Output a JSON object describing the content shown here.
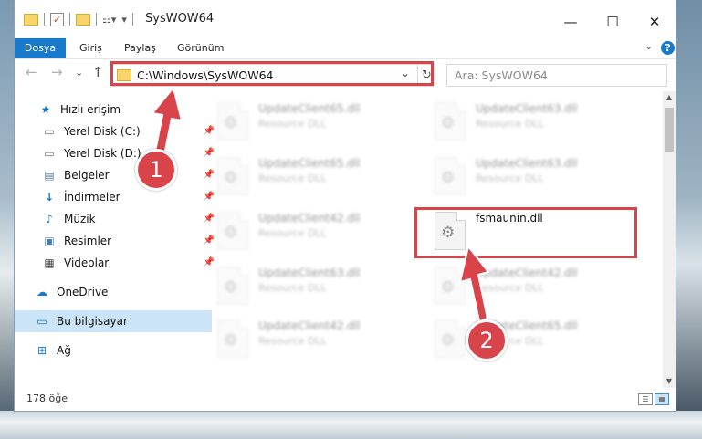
{
  "window": {
    "title": "SysWOW64"
  },
  "window_controls": {
    "minimize": "—",
    "maximize": "☐",
    "close": "✕"
  },
  "menu": {
    "items": [
      "Dosya",
      "Giriş",
      "Paylaş",
      "Görünüm"
    ]
  },
  "navigation": {
    "back": "←",
    "forward": "→",
    "recent": "⌄",
    "up": "↑"
  },
  "address": {
    "path": "C:\\Windows\\SysWOW64",
    "dropdown": "⌄",
    "refresh": "↻"
  },
  "search": {
    "placeholder": "Ara: SysWOW64"
  },
  "sidebar": {
    "items": [
      {
        "label": "Hızlı erişim",
        "icon": "star-icon"
      },
      {
        "label": "Yerel Disk (C:)",
        "icon": "drive-icon"
      },
      {
        "label": "Yerel Disk (D:)",
        "icon": "drive-icon"
      },
      {
        "label": "Belgeler",
        "icon": "documents-icon"
      },
      {
        "label": "İndirmeler",
        "icon": "download-icon"
      },
      {
        "label": "Müzik",
        "icon": "music-icon"
      },
      {
        "label": "Resimler",
        "icon": "pictures-icon"
      },
      {
        "label": "Videolar",
        "icon": "video-icon"
      },
      {
        "label": "OneDrive",
        "icon": "cloud-icon"
      },
      {
        "label": "Bu bilgisayar",
        "icon": "computer-icon"
      },
      {
        "label": "Ağ",
        "icon": "network-icon"
      }
    ]
  },
  "files": [
    {
      "name": "UpdateClient65.dll",
      "desc": "Resource DLL"
    },
    {
      "name": "UpdateClient63.dll",
      "desc": "Resource DLL"
    },
    {
      "name": "UpdateClient65.dll",
      "desc": "Resource DLL"
    },
    {
      "name": "UpdateClient63.dll",
      "desc": "Resource DLL"
    },
    {
      "name": "UpdateClient42.dll",
      "desc": "Resource DLL"
    },
    {
      "name": "fsmaunin.dll",
      "desc": ""
    },
    {
      "name": "UpdateClient63.dll",
      "desc": "Resource DLL"
    },
    {
      "name": "UpdateClient42.dll",
      "desc": "Resource DLL"
    },
    {
      "name": "UpdateClient42.dll",
      "desc": "Resource DLL"
    },
    {
      "name": "UpdateClient65.dll",
      "desc": "Resource DLL"
    }
  ],
  "status": {
    "item_count": "178 öğe"
  },
  "callouts": [
    "1",
    "2"
  ],
  "colors": {
    "accent": "#1979ca",
    "highlight": "#d9434a",
    "selected": "#cce4f7"
  }
}
